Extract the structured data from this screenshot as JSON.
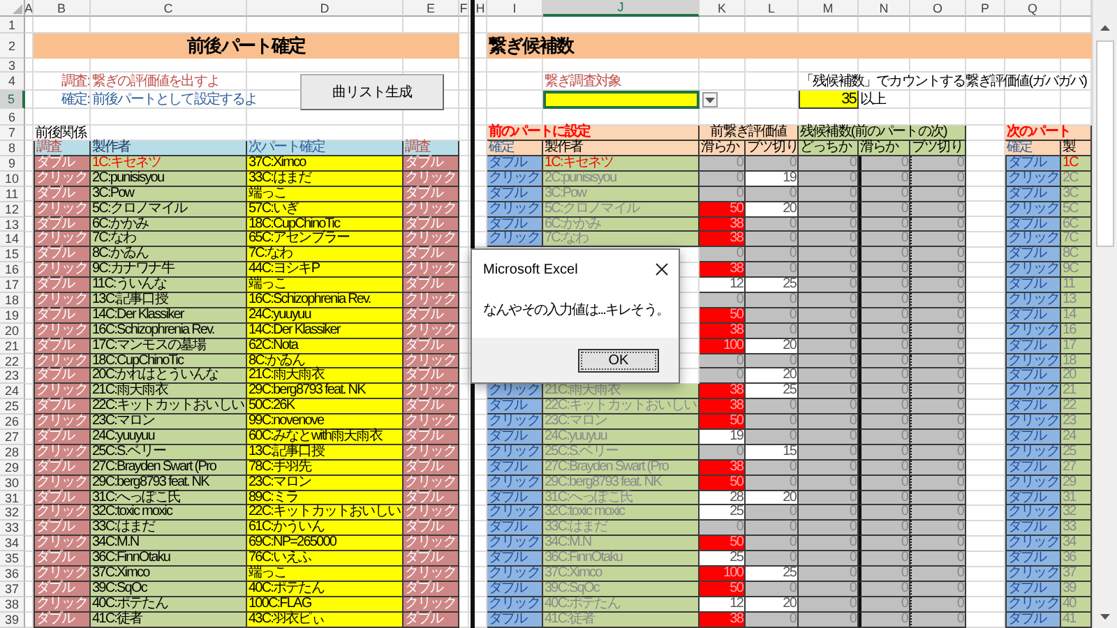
{
  "column_headers": [
    {
      "label": "A",
      "selected": false
    },
    {
      "label": "B",
      "selected": false
    },
    {
      "label": "C",
      "selected": false
    },
    {
      "label": "D",
      "selected": false
    },
    {
      "label": "E",
      "selected": false
    },
    {
      "label": "F",
      "selected": false
    },
    {
      "label": "H",
      "selected": false
    },
    {
      "label": "I",
      "selected": false
    },
    {
      "label": "J",
      "selected": true
    },
    {
      "label": "K",
      "selected": false
    },
    {
      "label": "L",
      "selected": false
    },
    {
      "label": "M",
      "selected": false
    },
    {
      "label": "N",
      "selected": false
    },
    {
      "label": "O",
      "selected": false
    },
    {
      "label": "P",
      "selected": false
    },
    {
      "label": "Q",
      "selected": false
    }
  ],
  "row_numbers": [
    {
      "label": "1",
      "selected": false
    },
    {
      "label": "2",
      "selected": false
    },
    {
      "label": "3",
      "selected": false
    },
    {
      "label": "4",
      "selected": false
    },
    {
      "label": "5",
      "selected": true
    },
    {
      "label": "6",
      "selected": false
    },
    {
      "label": "7",
      "selected": false
    },
    {
      "label": "8",
      "selected": false
    },
    {
      "label": "9",
      "selected": false
    },
    {
      "label": "10",
      "selected": false
    },
    {
      "label": "11",
      "selected": false
    },
    {
      "label": "12",
      "selected": false
    },
    {
      "label": "13",
      "selected": false
    },
    {
      "label": "14",
      "selected": false
    },
    {
      "label": "15",
      "selected": false
    },
    {
      "label": "16",
      "selected": false
    },
    {
      "label": "17",
      "selected": false
    },
    {
      "label": "18",
      "selected": false
    },
    {
      "label": "19",
      "selected": false
    },
    {
      "label": "20",
      "selected": false
    },
    {
      "label": "21",
      "selected": false
    },
    {
      "label": "22",
      "selected": false
    },
    {
      "label": "23",
      "selected": false
    },
    {
      "label": "24",
      "selected": false
    },
    {
      "label": "25",
      "selected": false
    },
    {
      "label": "26",
      "selected": false
    },
    {
      "label": "27",
      "selected": false
    },
    {
      "label": "28",
      "selected": false
    },
    {
      "label": "29",
      "selected": false
    },
    {
      "label": "30",
      "selected": false
    },
    {
      "label": "31",
      "selected": false
    },
    {
      "label": "32",
      "selected": false
    },
    {
      "label": "33",
      "selected": false
    },
    {
      "label": "34",
      "selected": false
    },
    {
      "label": "35",
      "selected": false
    },
    {
      "label": "36",
      "selected": false
    },
    {
      "label": "37",
      "selected": false
    },
    {
      "label": "38",
      "selected": false
    },
    {
      "label": "39",
      "selected": false
    }
  ],
  "part_confirm": {
    "title": "前後パート確定",
    "notes": [
      {
        "kind": "survey",
        "label": "調査:",
        "text": "繋ぎの評価値を出すよ"
      },
      {
        "kind": "confirm",
        "label": "確定:",
        "text": "前後パートとして設定するよ"
      }
    ],
    "button": "曲リスト生成",
    "caption": "前後関係",
    "headers": [
      "調査",
      "製作者",
      "次パート確定",
      "調査"
    ],
    "rows": [
      {
        "survey": "ダブル",
        "producer": "1C:キセネツ",
        "next": "37C:Ximco",
        "survey_2": "ダブル",
        "current": true
      },
      {
        "survey": "クリック",
        "producer": "2C:punisisyou",
        "next": "33C:はまだ",
        "survey_2": "クリック",
        "current": false
      },
      {
        "survey": "ダブル",
        "producer": "3C:Pow",
        "next": "端っこ",
        "survey_2": "ダブル",
        "current": false
      },
      {
        "survey": "クリック",
        "producer": "5C:クロノマイル",
        "next": "57C:いぎ",
        "survey_2": "クリック",
        "current": false
      },
      {
        "survey": "ダブル",
        "producer": "6C:かかみ",
        "next": "18C:CupChinoTic",
        "survey_2": "ダブル",
        "current": false
      },
      {
        "survey": "クリック",
        "producer": "7C:なわ",
        "next": "65C:アセンブラー",
        "survey_2": "クリック",
        "current": false
      },
      {
        "survey": "ダブル",
        "producer": "8C:かゐん",
        "next": "7C:なわ",
        "survey_2": "ダブル",
        "current": false
      },
      {
        "survey": "クリック",
        "producer": "9C:カナワナ牛",
        "next": "44C:ヨシキP",
        "survey_2": "クリック",
        "current": false
      },
      {
        "survey": "ダブル",
        "producer": "11C:ういんな",
        "next": "端っこ",
        "survey_2": "ダブル",
        "current": false
      },
      {
        "survey": "クリック",
        "producer": "13C:記事口授",
        "next": "16C:Schizophrenia Rev.",
        "survey_2": "クリック",
        "current": false
      },
      {
        "survey": "ダブル",
        "producer": "14C:Der Klassiker",
        "next": "24C:yuuyuu",
        "survey_2": "ダブル",
        "current": false
      },
      {
        "survey": "クリック",
        "producer": "16C:Schizophrenia Rev.",
        "next": "14C:Der Klassiker",
        "survey_2": "クリック",
        "current": false
      },
      {
        "survey": "ダブル",
        "producer": "17C:マンモスの墓場",
        "next": "62C:Nota",
        "survey_2": "ダブル",
        "current": false
      },
      {
        "survey": "クリック",
        "producer": "18C:CupChinoTic",
        "next": "8C:かゐん",
        "survey_2": "クリック",
        "current": false
      },
      {
        "survey": "ダブル",
        "producer": "20C:かれはとういんな",
        "next": "21C:雨天雨衣",
        "survey_2": "ダブル",
        "current": false
      },
      {
        "survey": "クリック",
        "producer": "21C:雨天雨衣",
        "next": "29C:berg8793 feat. NK",
        "survey_2": "クリック",
        "current": false
      },
      {
        "survey": "ダブル",
        "producer": "22C:キットカットおいしい",
        "next": "50C:26K",
        "survey_2": "ダブル",
        "current": false
      },
      {
        "survey": "クリック",
        "producer": "23C:マロン",
        "next": "99C:novenove",
        "survey_2": "クリック",
        "current": false
      },
      {
        "survey": "ダブル",
        "producer": "24C:yuuyuu",
        "next": "60C:みなとwith雨天雨衣",
        "survey_2": "ダブル",
        "current": false
      },
      {
        "survey": "クリック",
        "producer": "25C:S.ベリー",
        "next": "13C:記事口授",
        "survey_2": "クリック",
        "current": false
      },
      {
        "survey": "ダブル",
        "producer": "27C:Brayden Swart (Pro",
        "next": "78C:手羽先",
        "survey_2": "ダブル",
        "current": false
      },
      {
        "survey": "クリック",
        "producer": "29C:berg8793 feat. NK",
        "next": "23C:マロン",
        "survey_2": "クリック",
        "current": false
      },
      {
        "survey": "ダブル",
        "producer": "31C:へっぽこ氏",
        "next": "89C:ミラ",
        "survey_2": "ダブル",
        "current": false
      },
      {
        "survey": "クリック",
        "producer": "32C:toxic moxic",
        "next": "22C:キットカットおいしい",
        "survey_2": "クリック",
        "current": false
      },
      {
        "survey": "ダブル",
        "producer": "33C:はまだ",
        "next": "61C:かういん",
        "survey_2": "ダブル",
        "current": false
      },
      {
        "survey": "クリック",
        "producer": "34C:M.N",
        "next": "69C:NP=265000",
        "survey_2": "クリック",
        "current": false
      },
      {
        "survey": "ダブル",
        "producer": "36C:FinnOtaku",
        "next": "76C:いえふ",
        "survey_2": "ダブル",
        "current": false
      },
      {
        "survey": "クリック",
        "producer": "37C:Ximco",
        "next": "端っこ",
        "survey_2": "クリック",
        "current": false
      },
      {
        "survey": "ダブル",
        "producer": "39C:SqOc",
        "next": "40C:ポテたん",
        "survey_2": "ダブル",
        "current": false
      },
      {
        "survey": "クリック",
        "producer": "40C:ポテたん",
        "next": "100C:FLAG",
        "survey_2": "クリック",
        "current": false
      },
      {
        "survey": "ダブル",
        "producer": "41C:徒者",
        "next": "43C:羽衣ピぃ",
        "survey_2": "ダブル",
        "current": false
      }
    ]
  },
  "link_candidates": {
    "title": "繋ぎ候補数",
    "target_label": "繋ぎ調査対象",
    "threshold_label": "「残候補数」でカウントする繋ぎ評価値(ガバガバ)",
    "threshold": "35",
    "threshold_unit": "以上",
    "groups": [
      "前のパートに設定",
      "前繋ぎ評価値",
      "残候補数(前のパートの次)",
      "次のパート"
    ],
    "headers": [
      "確定",
      "製作者",
      "滑らか",
      "ブツ切り",
      "どっちか",
      "滑らか",
      "ブツ切り",
      "確定",
      "製"
    ],
    "rows": [
      {
        "confirm": "ダブル",
        "producer": "1C:キセネツ",
        "current": true,
        "smooth": {
          "text": "0",
          "color": "#c0c0c0"
        },
        "cut": {
          "text": "0",
          "color": "#c0c0c0"
        },
        "either": "0",
        "smooth_2": "0",
        "cut_2": "0",
        "next_confirm": "ダブル",
        "next_producer": "1C"
      },
      {
        "confirm": "クリック",
        "producer": "2C:punisisyou",
        "current": false,
        "smooth": {
          "text": "0",
          "color": "#c0c0c0"
        },
        "cut": {
          "text": "19",
          "color": "#ffffff"
        },
        "either": "0",
        "smooth_2": "0",
        "cut_2": "0",
        "next_confirm": "クリック",
        "next_producer": "2C"
      },
      {
        "confirm": "ダブル",
        "producer": "3C:Pow",
        "current": false,
        "smooth": {
          "text": "0",
          "color": "#c0c0c0"
        },
        "cut": {
          "text": "0",
          "color": "#c0c0c0"
        },
        "either": "0",
        "smooth_2": "0",
        "cut_2": "0",
        "next_confirm": "ダブル",
        "next_producer": "3C"
      },
      {
        "confirm": "クリック",
        "producer": "5C:クロノマイル",
        "current": false,
        "smooth": {
          "text": "50",
          "color": "#ff0000"
        },
        "cut": {
          "text": "20",
          "color": "#ffffff"
        },
        "either": "0",
        "smooth_2": "0",
        "cut_2": "0",
        "next_confirm": "クリック",
        "next_producer": "5C"
      },
      {
        "confirm": "ダブル",
        "producer": "6C:かかみ",
        "current": false,
        "smooth": {
          "text": "38",
          "color": "#ff0000"
        },
        "cut": {
          "text": "0",
          "color": "#c0c0c0"
        },
        "either": "0",
        "smooth_2": "0",
        "cut_2": "0",
        "next_confirm": "ダブル",
        "next_producer": "6C"
      },
      {
        "confirm": "クリック",
        "producer": "7C:なわ",
        "current": false,
        "smooth": {
          "text": "38",
          "color": "#ff0000"
        },
        "cut": {
          "text": "0",
          "color": "#c0c0c0"
        },
        "either": "0",
        "smooth_2": "0",
        "cut_2": "0",
        "next_confirm": "クリック",
        "next_producer": "7C"
      },
      {
        "current": false,
        "smooth": {
          "text": "0",
          "color": "#c0c0c0"
        },
        "cut": {
          "text": "0",
          "color": "#c0c0c0"
        },
        "either": "0",
        "smooth_2": "0",
        "cut_2": "0",
        "next_confirm": "ダブル",
        "next_producer": "8C"
      },
      {
        "current": false,
        "smooth": {
          "text": "38",
          "color": "#ff0000"
        },
        "cut": {
          "text": "0",
          "color": "#c0c0c0"
        },
        "either": "0",
        "smooth_2": "0",
        "cut_2": "0",
        "next_confirm": "クリック",
        "next_producer": "9C"
      },
      {
        "current": false,
        "smooth": {
          "text": "12",
          "color": "#ffffff"
        },
        "cut": {
          "text": "25",
          "color": "#ffffff"
        },
        "either": "0",
        "smooth_2": "0",
        "cut_2": "0",
        "next_confirm": "ダブル",
        "next_producer": "11"
      },
      {
        "current": false,
        "smooth": {
          "text": "0",
          "color": "#c0c0c0"
        },
        "cut": {
          "text": "0",
          "color": "#c0c0c0"
        },
        "either": "0",
        "smooth_2": "0",
        "cut_2": "0",
        "next_confirm": "クリック",
        "next_producer": "13"
      },
      {
        "current": false,
        "smooth": {
          "text": "50",
          "color": "#ff0000"
        },
        "cut": {
          "text": "0",
          "color": "#c0c0c0"
        },
        "either": "0",
        "smooth_2": "0",
        "cut_2": "0",
        "next_confirm": "ダブル",
        "next_producer": "14"
      },
      {
        "current": false,
        "smooth": {
          "text": "38",
          "color": "#ff0000"
        },
        "cut": {
          "text": "0",
          "color": "#c0c0c0"
        },
        "either": "0",
        "smooth_2": "0",
        "cut_2": "0",
        "next_confirm": "クリック",
        "next_producer": "16"
      },
      {
        "current": false,
        "smooth": {
          "text": "100",
          "color": "#ff0000"
        },
        "cut": {
          "text": "20",
          "color": "#ffffff"
        },
        "either": "0",
        "smooth_2": "0",
        "cut_2": "0",
        "next_confirm": "ダブル",
        "next_producer": "17"
      },
      {
        "current": false,
        "smooth": {
          "text": "0",
          "color": "#c0c0c0"
        },
        "cut": {
          "text": "0",
          "color": "#c0c0c0"
        },
        "either": "0",
        "smooth_2": "0",
        "cut_2": "0",
        "next_confirm": "クリック",
        "next_producer": "18"
      },
      {
        "current": false,
        "smooth": {
          "text": "0",
          "color": "#c0c0c0"
        },
        "cut": {
          "text": "20",
          "color": "#ffffff"
        },
        "either": "0",
        "smooth_2": "0",
        "cut_2": "0",
        "next_confirm": "ダブル",
        "next_producer": "20"
      },
      {
        "confirm": "クリック",
        "producer": "21C:雨天雨衣",
        "current": false,
        "smooth": {
          "text": "38",
          "color": "#ff0000"
        },
        "cut": {
          "text": "25",
          "color": "#ffffff"
        },
        "either": "0",
        "smooth_2": "0",
        "cut_2": "0",
        "next_confirm": "クリック",
        "next_producer": "21"
      },
      {
        "confirm": "ダブル",
        "producer": "22C:キットカットおいしい",
        "current": false,
        "smooth": {
          "text": "38",
          "color": "#ff0000"
        },
        "cut": {
          "text": "0",
          "color": "#c0c0c0"
        },
        "either": "0",
        "smooth_2": "0",
        "cut_2": "0",
        "next_confirm": "ダブル",
        "next_producer": "22"
      },
      {
        "confirm": "クリック",
        "producer": "23C:マロン",
        "current": false,
        "smooth": {
          "text": "50",
          "color": "#ff0000"
        },
        "cut": {
          "text": "0",
          "color": "#c0c0c0"
        },
        "either": "0",
        "smooth_2": "0",
        "cut_2": "0",
        "next_confirm": "クリック",
        "next_producer": "23"
      },
      {
        "confirm": "ダブル",
        "producer": "24C:yuuyuu",
        "current": false,
        "smooth": {
          "text": "19",
          "color": "#ffffff"
        },
        "cut": {
          "text": "0",
          "color": "#c0c0c0"
        },
        "either": "0",
        "smooth_2": "0",
        "cut_2": "0",
        "next_confirm": "ダブル",
        "next_producer": "24"
      },
      {
        "confirm": "クリック",
        "producer": "25C:S.ベリー",
        "current": false,
        "smooth": {
          "text": "0",
          "color": "#c0c0c0"
        },
        "cut": {
          "text": "15",
          "color": "#ffffff"
        },
        "either": "0",
        "smooth_2": "0",
        "cut_2": "0",
        "next_confirm": "クリック",
        "next_producer": "25"
      },
      {
        "confirm": "ダブル",
        "producer": "27C:Brayden Swart (Pro",
        "current": false,
        "smooth": {
          "text": "38",
          "color": "#ff0000"
        },
        "cut": {
          "text": "0",
          "color": "#c0c0c0"
        },
        "either": "0",
        "smooth_2": "0",
        "cut_2": "0",
        "next_confirm": "ダブル",
        "next_producer": "27"
      },
      {
        "confirm": "クリック",
        "producer": "29C:berg8793 feat. NK",
        "current": false,
        "smooth": {
          "text": "50",
          "color": "#ff0000"
        },
        "cut": {
          "text": "0",
          "color": "#c0c0c0"
        },
        "either": "0",
        "smooth_2": "0",
        "cut_2": "0",
        "next_confirm": "クリック",
        "next_producer": "29"
      },
      {
        "confirm": "ダブル",
        "producer": "31C:へっぽこ氏",
        "current": false,
        "smooth": {
          "text": "28",
          "color": "#ffffff"
        },
        "cut": {
          "text": "20",
          "color": "#ffffff"
        },
        "either": "0",
        "smooth_2": "0",
        "cut_2": "0",
        "next_confirm": "ダブル",
        "next_producer": "31"
      },
      {
        "confirm": "クリック",
        "producer": "32C:toxic moxic",
        "current": false,
        "smooth": {
          "text": "25",
          "color": "#ffffff"
        },
        "cut": {
          "text": "0",
          "color": "#c0c0c0"
        },
        "either": "0",
        "smooth_2": "0",
        "cut_2": "0",
        "next_confirm": "クリック",
        "next_producer": "32"
      },
      {
        "confirm": "ダブル",
        "producer": "33C:はまだ",
        "current": false,
        "smooth": {
          "text": "0",
          "color": "#c0c0c0"
        },
        "cut": {
          "text": "0",
          "color": "#c0c0c0"
        },
        "either": "0",
        "smooth_2": "0",
        "cut_2": "0",
        "next_confirm": "ダブル",
        "next_producer": "33"
      },
      {
        "confirm": "クリック",
        "producer": "34C:M.N",
        "current": false,
        "smooth": {
          "text": "50",
          "color": "#ff0000"
        },
        "cut": {
          "text": "0",
          "color": "#c0c0c0"
        },
        "either": "0",
        "smooth_2": "0",
        "cut_2": "0",
        "next_confirm": "クリック",
        "next_producer": "34"
      },
      {
        "confirm": "ダブル",
        "producer": "36C:FinnOtaku",
        "current": false,
        "smooth": {
          "text": "25",
          "color": "#ffffff"
        },
        "cut": {
          "text": "0",
          "color": "#c0c0c0"
        },
        "either": "0",
        "smooth_2": "0",
        "cut_2": "0",
        "next_confirm": "ダブル",
        "next_producer": "36"
      },
      {
        "confirm": "クリック",
        "producer": "37C:Ximco",
        "current": false,
        "smooth": {
          "text": "100",
          "color": "#ff0000"
        },
        "cut": {
          "text": "25",
          "color": "#ffffff"
        },
        "either": "0",
        "smooth_2": "0",
        "cut_2": "0",
        "next_confirm": "クリック",
        "next_producer": "37"
      },
      {
        "confirm": "ダブル",
        "producer": "39C:SqOc",
        "current": false,
        "smooth": {
          "text": "50",
          "color": "#ff0000"
        },
        "cut": {
          "text": "0",
          "color": "#c0c0c0"
        },
        "either": "0",
        "smooth_2": "0",
        "cut_2": "0",
        "next_confirm": "ダブル",
        "next_producer": "39"
      },
      {
        "confirm": "クリック",
        "producer": "40C:ポテたん",
        "current": false,
        "smooth": {
          "text": "12",
          "color": "#ffffff"
        },
        "cut": {
          "text": "20",
          "color": "#ffffff"
        },
        "either": "0",
        "smooth_2": "0",
        "cut_2": "0",
        "next_confirm": "クリック",
        "next_producer": "40"
      },
      {
        "confirm": "ダブル",
        "producer": "41C:徒者",
        "current": false,
        "smooth": {
          "text": "38",
          "color": "#ff0000"
        },
        "cut": {
          "text": "0",
          "color": "#c0c0c0"
        },
        "either": "0",
        "smooth_2": "0",
        "cut_2": "0",
        "next_confirm": "ダブル",
        "next_producer": "41"
      }
    ]
  },
  "dialog": {
    "title": "Microsoft Excel",
    "message": "なんやその入力値は...キレそう。",
    "button": "OK"
  }
}
